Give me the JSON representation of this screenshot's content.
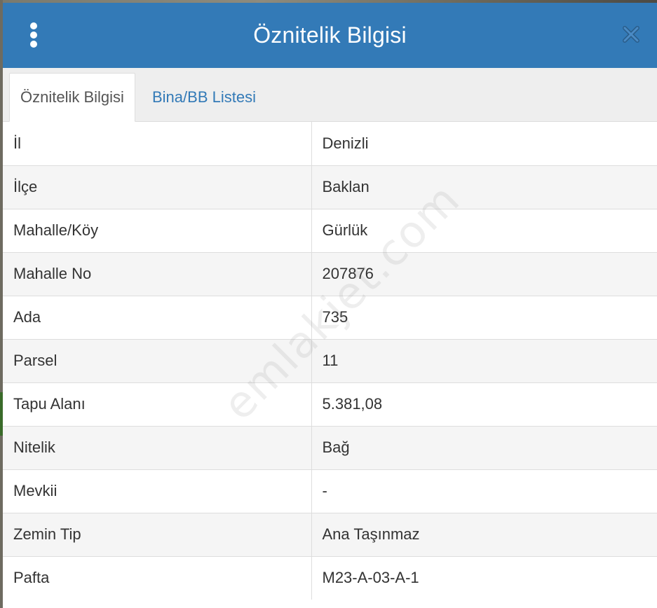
{
  "dialog": {
    "title": "Öznitelik Bilgisi",
    "menu_icon": "vertical-dots-icon",
    "close_icon": "close-icon",
    "header_color": "#337ab7"
  },
  "tabs": [
    {
      "label": "Öznitelik Bilgisi",
      "active": true
    },
    {
      "label": "Bina/BB Listesi",
      "active": false
    }
  ],
  "attributes": [
    {
      "key": "İl",
      "value": "Denizli"
    },
    {
      "key": "İlçe",
      "value": "Baklan"
    },
    {
      "key": "Mahalle/Köy",
      "value": "Gürlük"
    },
    {
      "key": "Mahalle No",
      "value": "207876"
    },
    {
      "key": "Ada",
      "value": "735"
    },
    {
      "key": "Parsel",
      "value": "11"
    },
    {
      "key": "Tapu Alanı",
      "value": "5.381,08"
    },
    {
      "key": "Nitelik",
      "value": "Bağ"
    },
    {
      "key": "Mevkii",
      "value": "-"
    },
    {
      "key": "Zemin Tip",
      "value": "Ana Taşınmaz"
    },
    {
      "key": "Pafta",
      "value": "M23-A-03-A-1"
    }
  ],
  "watermark": "emlakjet.com"
}
